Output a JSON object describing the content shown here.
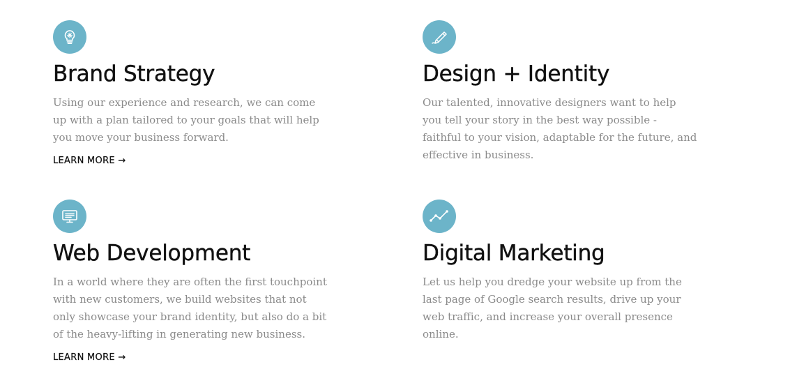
{
  "theme": {
    "icon_bg": "#6cb4c9",
    "title_color": "#111111",
    "text_color": "#8a8a8a"
  },
  "services": [
    {
      "icon": "lightbulb-icon",
      "title": "Brand Strategy",
      "description": "Using our experience and research, we can come up with a plan tailored to your goals that will help you move your business forward.",
      "link": "LEARN MORE →"
    },
    {
      "icon": "pencil-icon",
      "title": "Design + Identity",
      "description": "Our talented, innovative designers want to help you tell your story in the best way possible - faithful to your vision, adaptable for the future, and effective in business."
    },
    {
      "icon": "monitor-icon",
      "title": "Web Development",
      "description": "In a world where they are often the first touchpoint with new customers, we build websites that not only showcase your brand identity, but also do a bit of the heavy-lifting in generating new business.",
      "link": "LEARN MORE →"
    },
    {
      "icon": "line-graph-icon",
      "title": "Digital Marketing",
      "description": "Let us help you dredge your website up from the last page of Google search results, drive up your web traffic, and increase your overall presence online."
    }
  ]
}
